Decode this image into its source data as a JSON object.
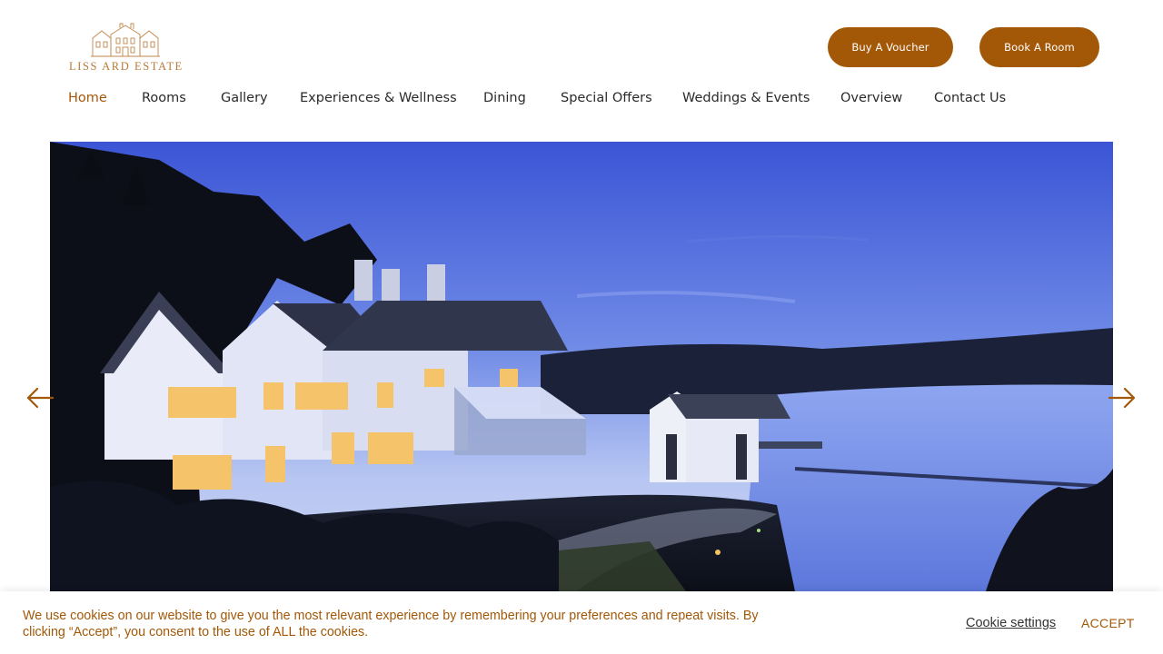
{
  "header": {
    "logo_text": "LISS ARD ESTATE",
    "buttons": {
      "voucher": "Buy A Voucher",
      "book_room": "Book A Room"
    }
  },
  "nav": {
    "items": [
      {
        "label": "Home",
        "active": true
      },
      {
        "label": "Rooms",
        "active": false
      },
      {
        "label": "Gallery",
        "active": false
      },
      {
        "label": "Experiences & Wellness",
        "active": false
      },
      {
        "label": "Dining",
        "active": false
      },
      {
        "label": "Special Offers",
        "active": false
      },
      {
        "label": "Weddings & Events",
        "active": false
      },
      {
        "label": "Overview",
        "active": false
      },
      {
        "label": "Contact Us",
        "active": false
      }
    ]
  },
  "hero": {
    "icons": {
      "previous": "arrow-left-icon",
      "next": "arrow-right-icon"
    }
  },
  "cookie_banner": {
    "message": "We use cookies on our website to give you the most relevant experience by remembering your preferences and repeat visits. By clicking “Accept”, you consent to the use of ALL the cookies.",
    "settings_label": "Cookie settings",
    "accept_label": "ACCEPT"
  },
  "colors": {
    "accent": "#a35808",
    "nav_text": "#2a2a2a",
    "logo": "#b77a3a"
  }
}
